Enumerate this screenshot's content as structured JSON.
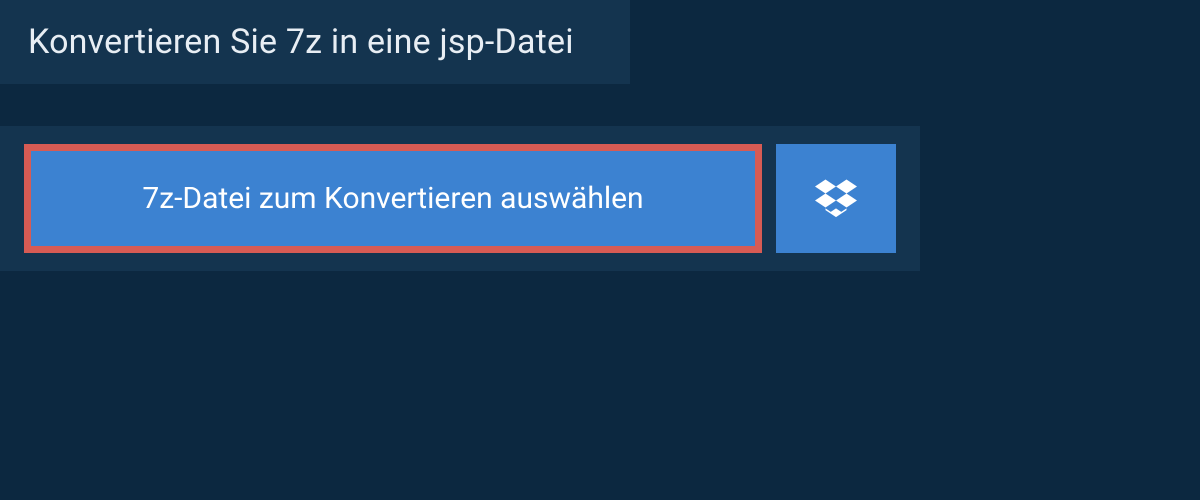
{
  "header": {
    "title": "Konvertieren Sie 7z in eine jsp-Datei"
  },
  "upload": {
    "select_file_label": "7z-Datei zum Konvertieren auswählen",
    "dropbox_icon": "dropbox-icon"
  },
  "colors": {
    "page_bg": "#0c2840",
    "panel_bg": "#14344f",
    "button_bg": "#3c82d1",
    "button_border_highlight": "#d75b54",
    "text_light": "#e8eef4",
    "text_white": "#ffffff"
  }
}
